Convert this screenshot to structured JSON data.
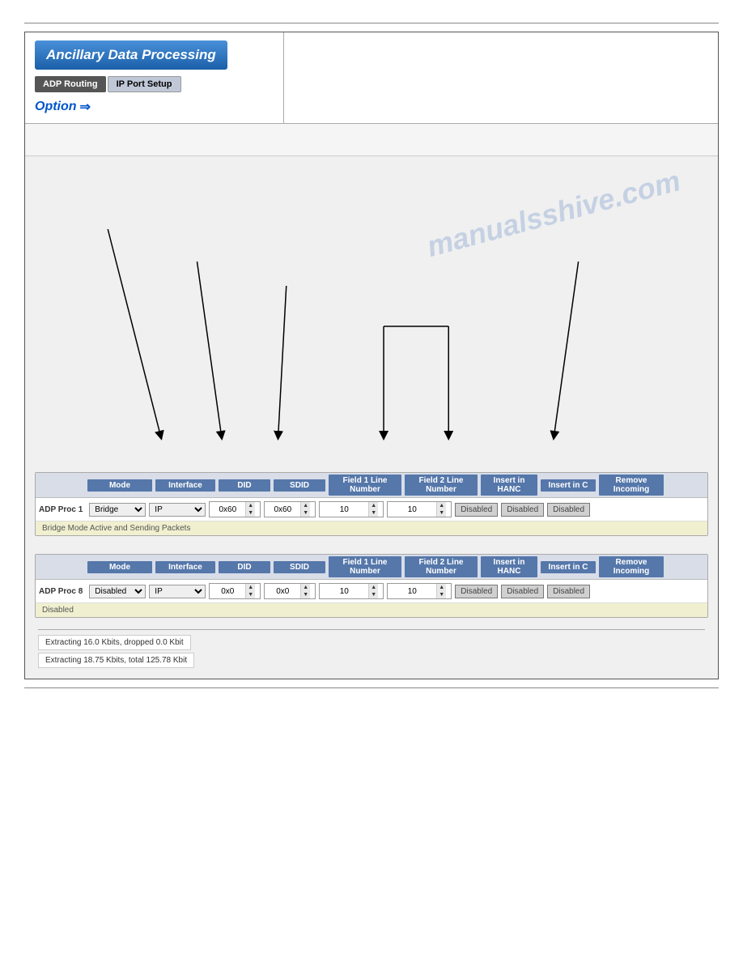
{
  "page": {
    "top_rule": true,
    "outer_border": true
  },
  "header": {
    "app_title": "Ancillary Data Processing",
    "tabs": [
      {
        "label": "ADP Routing",
        "active": true
      },
      {
        "label": "IP Port Setup",
        "active": false
      }
    ],
    "option_label": "Option",
    "option_icon": "⇒"
  },
  "watermark": {
    "line1": "manualsshive.com"
  },
  "proc1": {
    "label": "ADP Proc 1",
    "columns": {
      "mode": "Mode",
      "interface": "Interface",
      "did": "DID",
      "sdid": "SDID",
      "field1": "Field 1 Line Number",
      "field2": "Field 2 Line Number",
      "hanc": "Insert in HANC",
      "c": "Insert in C",
      "remove": "Remove Incoming"
    },
    "mode_value": "Bridge",
    "interface_value": "IP",
    "did_value": "0x60",
    "sdid_value": "0x60",
    "field1_value": "10",
    "field2_value": "10",
    "hanc_btn": "Disabled",
    "c_btn": "Disabled",
    "remove_btn": "Disabled",
    "status": "Bridge Mode Active and Sending Packets"
  },
  "proc8": {
    "label": "ADP Proc 8",
    "columns": {
      "mode": "Mode",
      "interface": "Interface",
      "did": "DID",
      "sdid": "SDID",
      "field1": "Field 1 Line Number",
      "field2": "Field 2 Line Number",
      "hanc": "Insert in HANC",
      "c": "Insert in C",
      "remove": "Remove Incoming"
    },
    "mode_value": "Disabled",
    "interface_value": "IP",
    "did_value": "0x0",
    "sdid_value": "0x0",
    "field1_value": "10",
    "field2_value": "10",
    "hanc_btn": "Disabled",
    "c_btn": "Disabled",
    "remove_btn": "Disabled",
    "status": "Disabled"
  },
  "log": {
    "entries": [
      "Extracting 16.0 Kbits, dropped 0.0 Kbit",
      "Extracting 18.75 Kbits, total 125.78 Kbit"
    ]
  }
}
